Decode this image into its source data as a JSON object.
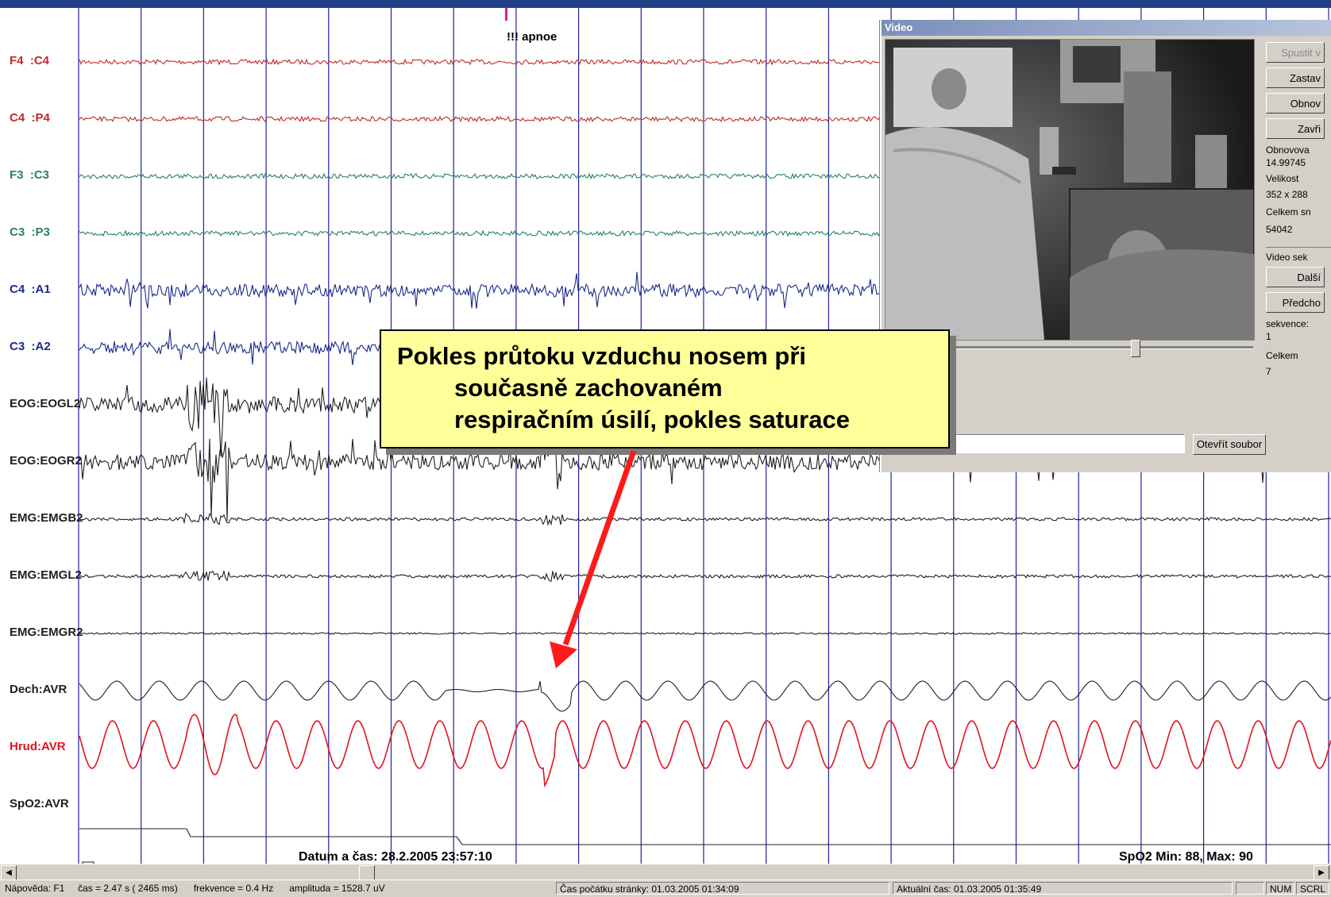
{
  "annotation": {
    "apnoe": "!!! apnoe"
  },
  "channels": [
    {
      "label": "F4  :C4",
      "color": "#c0282d",
      "trace": "eeg",
      "amp": 3
    },
    {
      "label": "C4  :P4",
      "color": "#c0282d",
      "trace": "eeg",
      "amp": 3
    },
    {
      "label": "F3  :C3",
      "color": "#2a7f6b",
      "trace": "eeg",
      "amp": 3
    },
    {
      "label": "C3  :P3",
      "color": "#2a7f6b",
      "trace": "eeg",
      "amp": 3
    },
    {
      "label": "C4  :A1",
      "color": "#1a2a8a",
      "trace": "eeg",
      "amp": 8
    },
    {
      "label": "C3  :A2",
      "color": "#1a2a8a",
      "trace": "eeg",
      "amp": 8
    },
    {
      "label": "EOG:EOGL2",
      "color": "#1f1f1f",
      "trace": "eeg",
      "amp": 10
    },
    {
      "label": "EOG:EOGR2",
      "color": "#1f1f1f",
      "trace": "eeg",
      "amp": 10
    },
    {
      "label": "EMG:EMGB2",
      "color": "#1f1f1f",
      "trace": "eeg",
      "amp": 2
    },
    {
      "label": "EMG:EMGL2",
      "color": "#1f1f1f",
      "trace": "eeg",
      "amp": 2
    },
    {
      "label": "EMG:EMGR2",
      "color": "#1f1f1f",
      "trace": "eeg",
      "amp": 1
    },
    {
      "label": "Dech:AVR",
      "color": "#1f1f1f",
      "trace": "resp",
      "amp": 12
    },
    {
      "label": "Hrud:AVR",
      "color": "#e0141e",
      "trace": "chest",
      "amp": 30
    },
    {
      "label": "SpO2:AVR",
      "color": "#1f1f1f",
      "trace": "spo2",
      "amp": 0
    }
  ],
  "footer": {
    "datetime": "Datum a čas: 28.2.2005 23:57:10",
    "spo2_stats": "SpO2 Min: 88, Max: 90"
  },
  "callout": {
    "line1": "Pokles průtoku vzduchu nosem při",
    "line2": "současně zachovaném",
    "line3": "respiračním úsilí, pokles saturace"
  },
  "video": {
    "title": "Video",
    "buttons": [
      "Spustit v",
      "Zastav",
      "Obnov",
      "Zavři"
    ],
    "refresh_label": "Obnovova",
    "refresh_value": "14.99745",
    "size_label": "Velikost",
    "size_value": "352 x 288",
    "total_frames_label": "Celkem sn",
    "total_frames_value": "54042",
    "section_label": "Video sek",
    "next_button": "Další",
    "prev_button": "Předcho",
    "sequence_label": "sekvence:",
    "sequence_value": "1",
    "total_label": "Celkem",
    "total_value": "7",
    "open_file_button": "Otevřít soubor"
  },
  "statusbar": {
    "help": "Nápověda: F1",
    "time": "čas = 2.47 s ( 2465 ms)",
    "frequency": "frekvence = 0.4 Hz",
    "amplitude": "amplituda = 1528.7 uV",
    "page_start": "Čas počátku stránky: 01.03.2005 01:34:09",
    "current_time": "Aktuální čas: 01.03.2005 01:35:49",
    "num": "NUM",
    "scrl": "SCRL"
  },
  "colors": {
    "grid": "#2020a0",
    "callout_bg": "#ffff99",
    "arrow": "#ff1a1a"
  }
}
